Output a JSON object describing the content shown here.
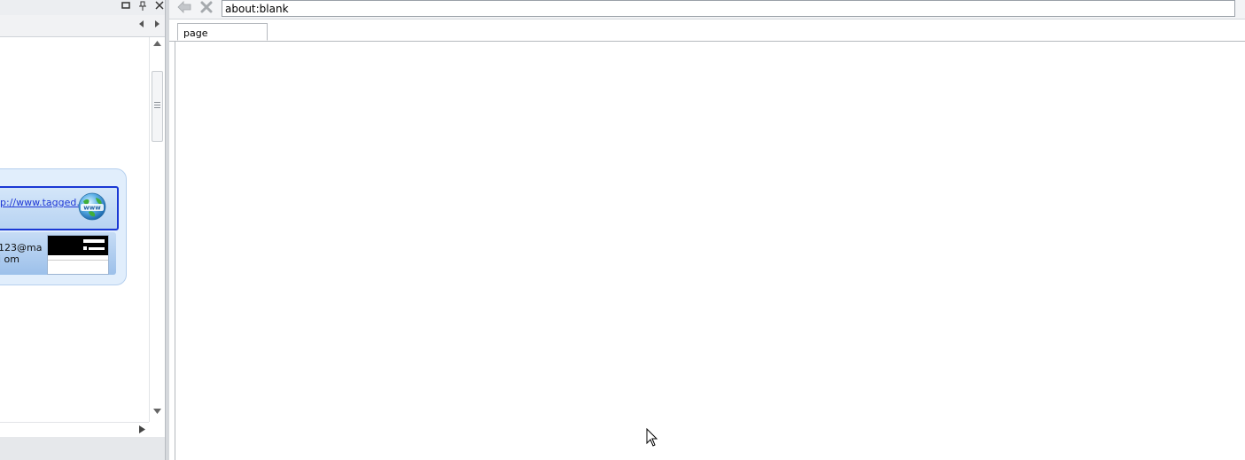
{
  "panel": {
    "titlebar_buttons": [
      "maximize-icon",
      "pin-icon",
      "close-icon"
    ],
    "nav": [
      "scroll-left-icon",
      "scroll-right-icon"
    ],
    "node": {
      "link_text": "p://www.tagged.c",
      "email_text": "123@mai om",
      "thumbnail_icon": "screenshot-thumbnail"
    }
  },
  "browser": {
    "back_icon": "back-arrow-icon",
    "stop_icon": "stop-icon",
    "url": "about:blank",
    "tabs": [
      {
        "label": "page"
      }
    ]
  },
  "colors": {
    "link": "#1f38d6",
    "selection_border": "#1a38d4",
    "node_bg": "#e1eefc"
  }
}
